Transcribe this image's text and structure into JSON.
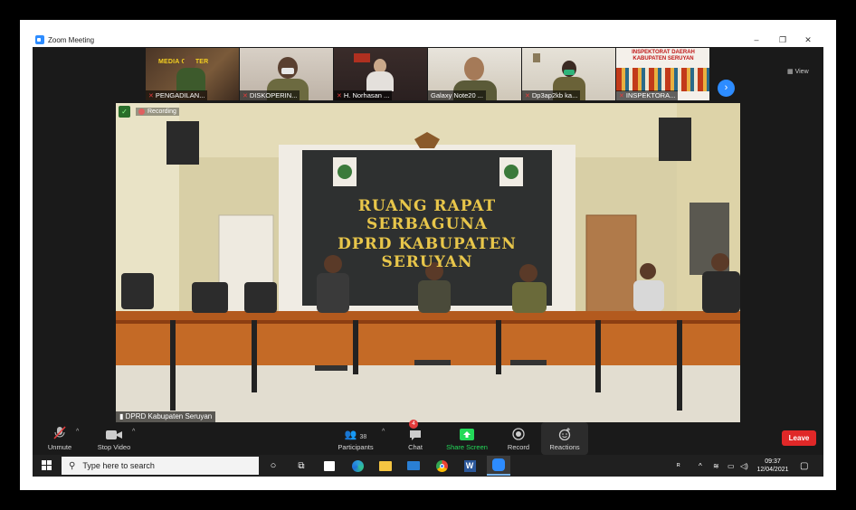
{
  "window": {
    "title": "Zoom Meeting",
    "controls": [
      "–",
      "❐",
      "✕"
    ]
  },
  "gallery": {
    "view_label": "View",
    "participants": [
      {
        "name": "PENGADILAN...",
        "muted": true,
        "overlay_text": "MEDIA CENTER"
      },
      {
        "name": "DISKOPERIN...",
        "muted": true
      },
      {
        "name": "H. Norhasan ...",
        "muted": true
      },
      {
        "name": "Galaxy Note20 ...",
        "muted": false
      },
      {
        "name": "Dp3ap2kb ka...",
        "muted": true
      },
      {
        "name": "INSPEKTORA...",
        "muted": true,
        "overlay_text": "INSPEKTORAT DAERAH KABUPATEN SERUYAN"
      }
    ]
  },
  "stage": {
    "recording_label": "Recording",
    "active_speaker": "DPRD Kabupaten Seruyan",
    "banner_line1": "RUANG RAPAT SERBAGUNA",
    "banner_line2": "DPRD KABUPATEN SERUYAN"
  },
  "toolbar": {
    "unmute": "Unmute",
    "stop_video": "Stop Video",
    "participants": "Participants",
    "participants_count": "38",
    "chat": "Chat",
    "chat_badge": "4",
    "share_screen": "Share Screen",
    "record": "Record",
    "reactions": "Reactions",
    "leave": "Leave",
    "share_color": "#23d959",
    "leave_color": "#e02828"
  },
  "taskbar": {
    "search_placeholder": "Type here to search",
    "time": "09:37",
    "date": "12/04/2021",
    "apps": [
      "task-view-icon",
      "microsoft-store-icon",
      "edge-icon",
      "file-explorer-icon",
      "mail-icon",
      "chrome-icon",
      "word-icon",
      "zoom-icon"
    ]
  }
}
